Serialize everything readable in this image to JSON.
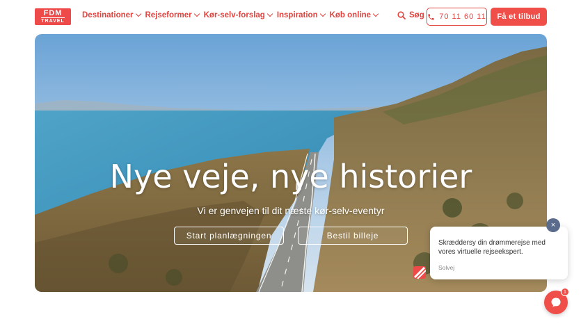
{
  "header": {
    "logo": {
      "line1": "FDM",
      "line2": "TRAVEL"
    },
    "nav": [
      {
        "label": "Destinationer"
      },
      {
        "label": "Rejseformer"
      },
      {
        "label": "Kør-selv-forslag"
      },
      {
        "label": "Inspiration"
      },
      {
        "label": "Køb online"
      }
    ],
    "search_label": "Søg",
    "phone": "70 11 60 11",
    "cta_label": "Få et tilbud"
  },
  "hero": {
    "title": "Nye veje, nye historier",
    "subtitle": "Vi er genvejen til dit næste kør-selv-eventyr",
    "buttons": [
      {
        "label": "Start planlægningen"
      },
      {
        "label": "Bestil billeje"
      }
    ]
  },
  "chat": {
    "message": "Skræddersy din drømmerejse med vores virtuelle rejseekspert.",
    "brand": "Solvej",
    "close_label": "×",
    "unread_count": "1"
  },
  "colors": {
    "brand": "#ef4a4a",
    "nav_text": "#e0443f",
    "close_button": "#5b6b8c"
  },
  "icons": [
    "search-icon",
    "phone-icon",
    "chevron-down-icon",
    "close-icon",
    "chat-icon"
  ]
}
